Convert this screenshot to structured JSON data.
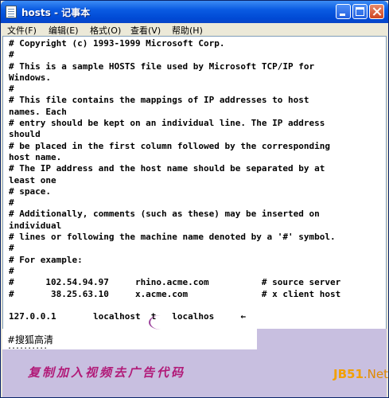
{
  "window": {
    "title": "hosts - 记事本"
  },
  "menu": {
    "items": [
      "文件(F)",
      "编辑(E)",
      "格式(O)",
      "查看(V)",
      "帮助(H)"
    ]
  },
  "editor": {
    "lines": [
      "# Copyright (c) 1993-1999 Microsoft Corp.",
      "#",
      "# This is a sample HOSTS file used by Microsoft TCP/IP for",
      "Windows.",
      "#",
      "# This file contains the mappings of IP addresses to host",
      "names. Each",
      "# entry should be kept on an individual line. The IP address",
      "should",
      "# be placed in the first column followed by the corresponding",
      "host name.",
      "# The IP address and the host name should be separated by at",
      "least one",
      "# space.",
      "#",
      "# Additionally, comments (such as these) may be inserted on",
      "individual",
      "# lines or following the machine name denoted by a '#' symbol.",
      "#",
      "# For example:",
      "#",
      "#      102.54.94.97     rhino.acme.com          # source server",
      "#       38.25.63.10     x.acme.com              # x client host",
      "",
      "127.0.0.1       localhost  t   localhos     ←"
    ]
  },
  "overlay": {
    "added_line": "#搜狐高清",
    "dots": "..........",
    "caption": "复制加入视频去广告代码",
    "watermark_a": "JB51",
    "watermark_b": ".Net"
  }
}
